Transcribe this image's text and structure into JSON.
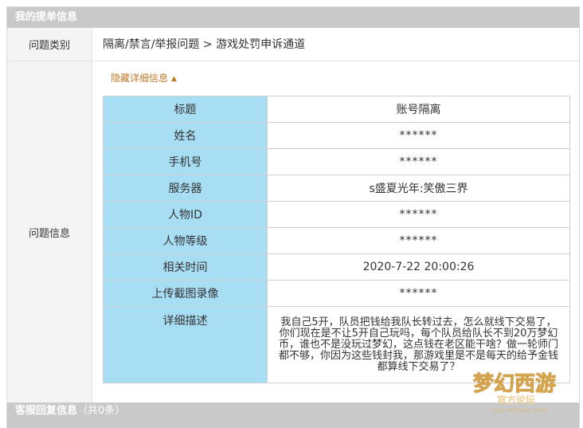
{
  "header": {
    "title": "我的提单信息"
  },
  "category": {
    "label": "问题类别",
    "value": "隔离/禁言/举报问题 > 游戏处罚申诉通道"
  },
  "info": {
    "label": "问题信息",
    "toggle_label": "隐藏详细信息",
    "rows": [
      {
        "key": "标题",
        "value": "账号隔离"
      },
      {
        "key": "姓名",
        "value": "******"
      },
      {
        "key": "手机号",
        "value": "******"
      },
      {
        "key": "服务器",
        "value": "s盛夏光年:笑傲三界"
      },
      {
        "key": "人物ID",
        "value": "******"
      },
      {
        "key": "人物等级",
        "value": "******"
      },
      {
        "key": "相关时间",
        "value": "2020-7-22 20:00:26"
      },
      {
        "key": "上传截图录像",
        "value": "******"
      },
      {
        "key": "详细描述",
        "value": "我自己5开，队员把钱给我队长转过去，怎么就线下交易了，你们现在是不让5开自己玩吗，每个队员给队长不到20万梦幻币，谁也不是没玩过梦幻，这点钱在老区能干啥？做一轮师门都不够，你因为这些钱封我，那游戏里是不是每天的给予金钱都算线下交易了？"
      }
    ]
  },
  "footer": {
    "title": "客服回复信息",
    "count": "（共0条）"
  },
  "watermark": {
    "logo_text": "梦幻西游",
    "sub_text": "官方论坛",
    "url": "xyq.netease.com"
  },
  "colors": {
    "header_bg": "#c9c9c9",
    "key_cell_bg": "#a8def4",
    "toggle_color": "#c07a2a",
    "link_color": "#2b72c2"
  }
}
